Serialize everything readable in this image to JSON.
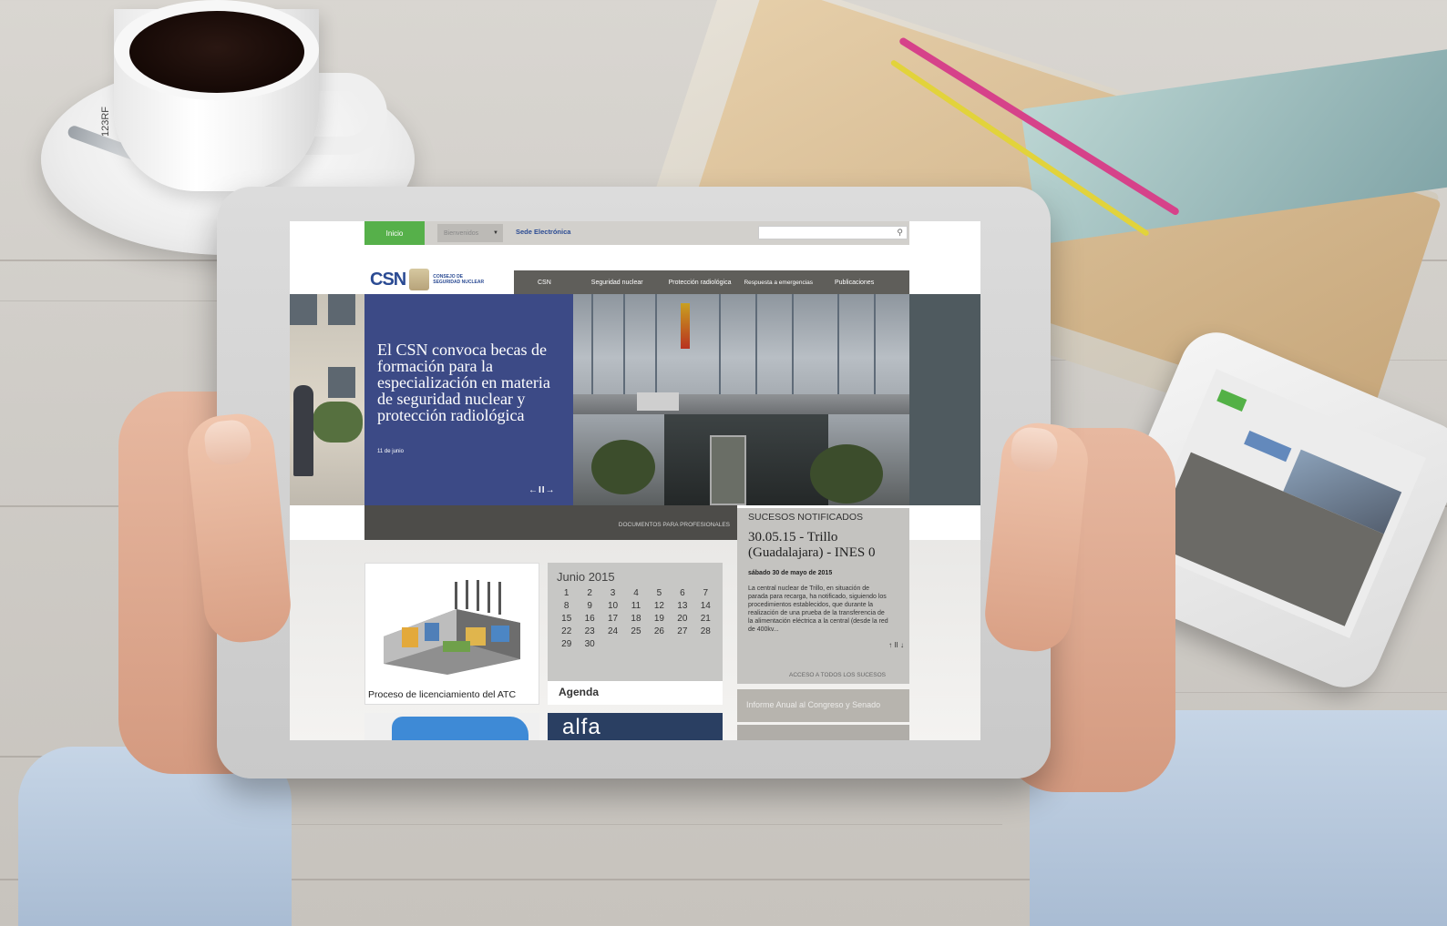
{
  "photo_credit": "123RF",
  "website": {
    "topbar": {
      "home_tab": "Inicio",
      "language_select": "Bienvenidos",
      "sede_link": "Sede Electrónica",
      "search_placeholder": ""
    },
    "logo": {
      "brand": "CSN",
      "subtitle": "CONSEJO DE SEGURIDAD NUCLEAR"
    },
    "nav": [
      "CSN",
      "Seguridad nuclear",
      "Protección radiológica",
      "Respuesta a emergencias",
      "Publicaciones"
    ],
    "hero": {
      "title": "El CSN convoca becas de formación para la especialización en materia de seguridad nuclear y protección radiológica",
      "date": "11 de junio",
      "controls": "←II→"
    },
    "docbar": "DOCUMENTOS PARA PROFESIONALES",
    "card_atc": {
      "label": "Proceso de licenciamiento del ATC"
    },
    "calendar": {
      "title": "Junio 2015",
      "days": [
        "1",
        "2",
        "3",
        "4",
        "5",
        "6",
        "7",
        "8",
        "9",
        "10",
        "11",
        "12",
        "13",
        "14",
        "15",
        "16",
        "17",
        "18",
        "19",
        "20",
        "21",
        "22",
        "23",
        "24",
        "25",
        "26",
        "27",
        "28",
        "29",
        "30"
      ],
      "agenda_label": "Agenda"
    },
    "alfa_label": "alfa",
    "sucesos": {
      "header": "SUCESOS NOTIFICADOS",
      "title": "30.05.15 - Trillo (Guadalajara) - INES 0",
      "date": "sábado 30 de mayo de 2015",
      "body": "La central nuclear de Trillo, en situación de parada para recarga, ha notificado, siguiendo los procedimientos establecidos, que durante la realización de una prueba de la transferencia de la alimentación eléctrica a la central (desde la red de 400kv...",
      "link": "ACCESO A TODOS LOS SUCESOS",
      "arrows": "↑ II ↓"
    },
    "informe": "Informe Anual al Congreso y Senado"
  },
  "colors": {
    "green": "#56b04a",
    "hero_blue": "#3c4a86",
    "nav_grey": "#5f5e5a"
  }
}
